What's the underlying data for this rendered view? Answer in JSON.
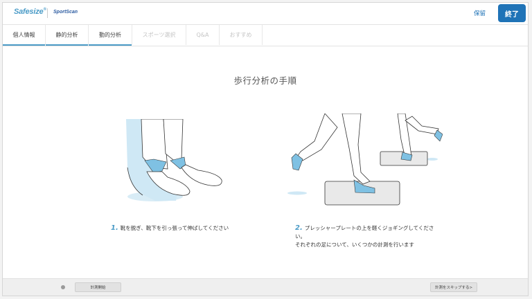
{
  "header": {
    "logo_primary": "Safesize",
    "logo_secondary": "SportScan",
    "save_label": "保留",
    "finish_label": "終了",
    "accent_color": "#1f73b7"
  },
  "tabs": [
    {
      "label": "個人情報",
      "state": "done"
    },
    {
      "label": "静的分析",
      "state": "done"
    },
    {
      "label": "動的分析",
      "state": "active"
    },
    {
      "label": "スポーツ選択",
      "state": "disabled"
    },
    {
      "label": "Q&A",
      "state": "disabled"
    },
    {
      "label": "おすすめ",
      "state": "disabled"
    }
  ],
  "main": {
    "title": "歩行分析の手順",
    "steps": [
      {
        "number": "1.",
        "text": "靴を脱ぎ、靴下を引っ張って伸ばしてください"
      },
      {
        "number": "2.",
        "text_line1": "プレッシャープレートの上を軽くジョギングしてくださ",
        "text_line2": "い。",
        "text_line3": "それぞれの足について、いくつかの計測を行います"
      }
    ]
  },
  "footer": {
    "start_label": "計測開始",
    "skip_label": "計測をスキップする>"
  }
}
